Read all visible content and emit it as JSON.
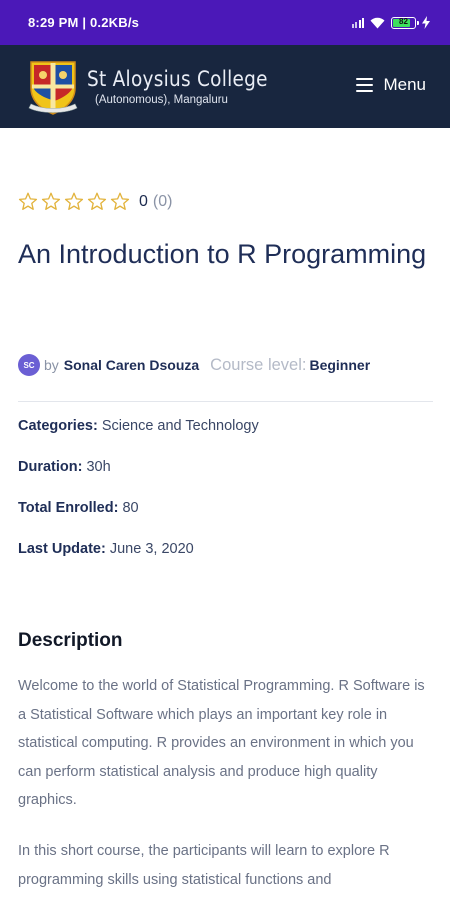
{
  "status_bar": {
    "time_speed": "8:29 PM | 0.2KB/s",
    "battery_level": "82",
    "icons": [
      "signal-icon",
      "wifi-icon",
      "battery-icon",
      "charging-bolt-icon"
    ]
  },
  "header": {
    "college_name": "St Aloysius College",
    "college_subtitle": "(Autonomous), Mangaluru",
    "menu_label": "Menu",
    "bg_color": "#18263f"
  },
  "course": {
    "rating": {
      "stars_filled": 0,
      "stars_total": 5,
      "value": "0",
      "count": "(0)"
    },
    "title": "An Introduction to R Programming",
    "author_initials": "SC",
    "by_label": "by",
    "author": "Sonal Caren Dsouza",
    "level_label": "Course level:",
    "level_value": "Beginner",
    "info": [
      {
        "label": "Categories:",
        "value": "Science and Technology"
      },
      {
        "label": "Duration:",
        "value": "30h"
      },
      {
        "label": "Total Enrolled:",
        "value": "80"
      },
      {
        "label": "Last Update:",
        "value": "June 3, 2020"
      }
    ],
    "description_heading": "Description",
    "description_p1": "Welcome to the world of Statistical Programming. R Software is a Statistical Software which plays an important key role in statistical computing. R provides  an environment  in  which  you  can perform statistical analysis and produce high quality graphics.",
    "description_p2": "In this short course, the participants will learn to explore R programming skills using statistical functions and"
  },
  "colors": {
    "status_bar": "#4b18b8",
    "star": "#e2b33c",
    "heading": "#1f2e57",
    "muted": "#8a93a6"
  }
}
